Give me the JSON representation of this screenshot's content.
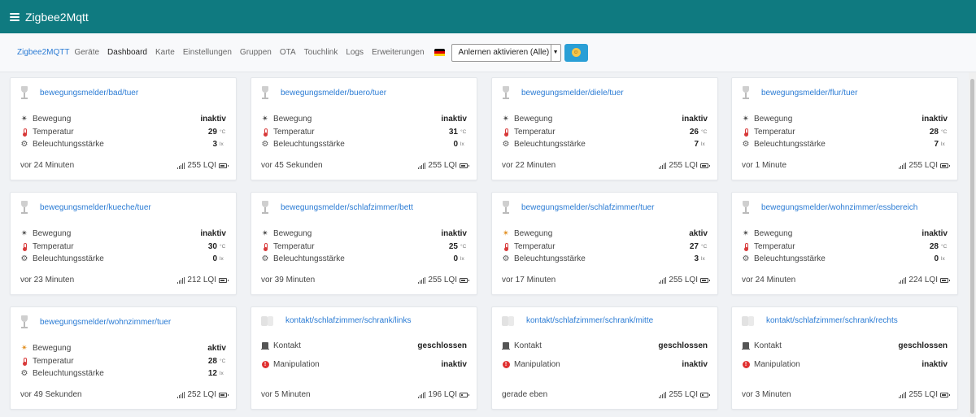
{
  "app": {
    "title": "Zigbee2Mqtt"
  },
  "nav": {
    "brand": "Zigbee2MQTT",
    "links": [
      "Geräte",
      "Dashboard",
      "Karte",
      "Einstellungen",
      "Gruppen",
      "OTA",
      "Touchlink",
      "Logs",
      "Erweiterungen"
    ],
    "active": "Dashboard",
    "permit_join_label": "Anlernen aktivieren (Alle)",
    "language_flag": "de-flag"
  },
  "labels": {
    "motion": "Bewegung",
    "temperature": "Temperatur",
    "illuminance": "Beleuchtungsstärke",
    "contact": "Kontakt",
    "tamper": "Manipulation",
    "temp_unit": "°C",
    "lux_unit": "lx",
    "lqi_suffix": "LQI"
  },
  "colors": {
    "topbar": "#0f7a80",
    "link": "#2a7bd4",
    "motion_active": "#e08b1a",
    "alert": "#e03131"
  },
  "devices": [
    {
      "name": "bewegungsmelder/bad/tuer",
      "type": "motion",
      "motion": "inaktiv",
      "temperature": "29",
      "illuminance": "3",
      "last_seen": "vor 24 Minuten",
      "lqi": "255",
      "battery": 0.9
    },
    {
      "name": "bewegungsmelder/buero/tuer",
      "type": "motion",
      "motion": "inaktiv",
      "temperature": "31",
      "illuminance": "0",
      "last_seen": "vor 45 Sekunden",
      "lqi": "255",
      "battery": 0.9
    },
    {
      "name": "bewegungsmelder/diele/tuer",
      "type": "motion",
      "motion": "inaktiv",
      "temperature": "26",
      "illuminance": "7",
      "last_seen": "vor 22 Minuten",
      "lqi": "255",
      "battery": 0.9
    },
    {
      "name": "bewegungsmelder/flur/tuer",
      "type": "motion",
      "motion": "inaktiv",
      "temperature": "28",
      "illuminance": "7",
      "last_seen": "vor 1 Minute",
      "lqi": "255",
      "battery": 0.9
    },
    {
      "name": "bewegungsmelder/kueche/tuer",
      "type": "motion",
      "motion": "inaktiv",
      "temperature": "30",
      "illuminance": "0",
      "last_seen": "vor 23 Minuten",
      "lqi": "212",
      "battery": 0.9
    },
    {
      "name": "bewegungsmelder/schlafzimmer/bett",
      "type": "motion",
      "motion": "inaktiv",
      "temperature": "25",
      "illuminance": "0",
      "last_seen": "vor 39 Minuten",
      "lqi": "255",
      "battery": 0.9
    },
    {
      "name": "bewegungsmelder/schlafzimmer/tuer",
      "type": "motion",
      "motion": "aktiv",
      "temperature": "27",
      "illuminance": "3",
      "last_seen": "vor 17 Minuten",
      "lqi": "255",
      "battery": 0.9
    },
    {
      "name": "bewegungsmelder/wohnzimmer/essbereich",
      "type": "motion",
      "motion": "inaktiv",
      "temperature": "28",
      "illuminance": "0",
      "last_seen": "vor 24 Minuten",
      "lqi": "224",
      "battery": 0.9
    },
    {
      "name": "bewegungsmelder/wohnzimmer/tuer",
      "type": "motion",
      "motion": "aktiv",
      "temperature": "28",
      "illuminance": "12",
      "last_seen": "vor 49 Sekunden",
      "lqi": "252",
      "battery": 0.9
    },
    {
      "name": "kontakt/schlafzimmer/schrank/links",
      "type": "contact",
      "contact": "geschlossen",
      "tamper": "inaktiv",
      "last_seen": "vor 5 Minuten",
      "lqi": "196",
      "battery": 0.3
    },
    {
      "name": "kontakt/schlafzimmer/schrank/mitte",
      "type": "contact",
      "contact": "geschlossen",
      "tamper": "inaktiv",
      "last_seen": "gerade eben",
      "lqi": "255",
      "battery": 0.3
    },
    {
      "name": "kontakt/schlafzimmer/schrank/rechts",
      "type": "contact",
      "contact": "geschlossen",
      "tamper": "inaktiv",
      "last_seen": "vor 3 Minuten",
      "lqi": "255",
      "battery": 0.9
    }
  ]
}
